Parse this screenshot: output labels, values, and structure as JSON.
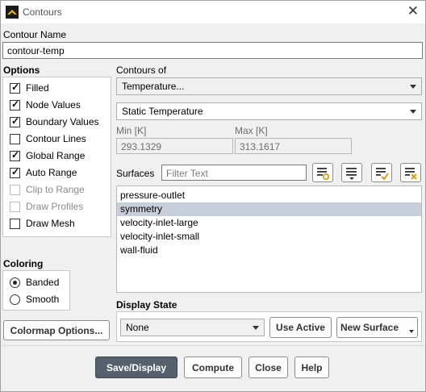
{
  "window": {
    "title": "Contours"
  },
  "contour_name": {
    "label": "Contour Name",
    "value": "contour-temp"
  },
  "options": {
    "label": "Options",
    "items": [
      {
        "label": "Filled",
        "checked": true,
        "enabled": true
      },
      {
        "label": "Node Values",
        "checked": true,
        "enabled": true
      },
      {
        "label": "Boundary Values",
        "checked": true,
        "enabled": true
      },
      {
        "label": "Contour Lines",
        "checked": false,
        "enabled": true
      },
      {
        "label": "Global Range",
        "checked": true,
        "enabled": true
      },
      {
        "label": "Auto Range",
        "checked": true,
        "enabled": true
      },
      {
        "label": "Clip to Range",
        "checked": false,
        "enabled": false
      },
      {
        "label": "Draw Profiles",
        "checked": false,
        "enabled": false
      },
      {
        "label": "Draw Mesh",
        "checked": false,
        "enabled": true
      }
    ]
  },
  "coloring": {
    "label": "Coloring",
    "items": [
      {
        "label": "Banded",
        "selected": true
      },
      {
        "label": "Smooth",
        "selected": false
      }
    ]
  },
  "contours_of": {
    "label": "Contours of",
    "category": "Temperature...",
    "quantity": "Static Temperature"
  },
  "range": {
    "min_label": "Min [K]",
    "min_value": "293.1329",
    "max_label": "Max [K]",
    "max_value": "313.1617"
  },
  "surfaces": {
    "label": "Surfaces",
    "filter_placeholder": "Filter Text",
    "items": [
      {
        "label": "pressure-outlet",
        "selected": false
      },
      {
        "label": "symmetry",
        "selected": true
      },
      {
        "label": "velocity-inlet-large",
        "selected": false
      },
      {
        "label": "velocity-inlet-small",
        "selected": false
      },
      {
        "label": "wall-fluid",
        "selected": false
      }
    ]
  },
  "display_state": {
    "label": "Display State",
    "value": "None",
    "use_active": "Use Active",
    "new_surface": "New Surface"
  },
  "buttons": {
    "colormap_options": "Colormap Options...",
    "save_display": "Save/Display",
    "compute": "Compute",
    "close": "Close",
    "help": "Help"
  },
  "icons": {
    "app": "ansys-fluent-icon",
    "close": "close-icon",
    "select_all": "select-all-icon",
    "select_group": "select-group-icon",
    "select_checked": "select-checked-icon",
    "deselect_all": "deselect-all-icon"
  }
}
